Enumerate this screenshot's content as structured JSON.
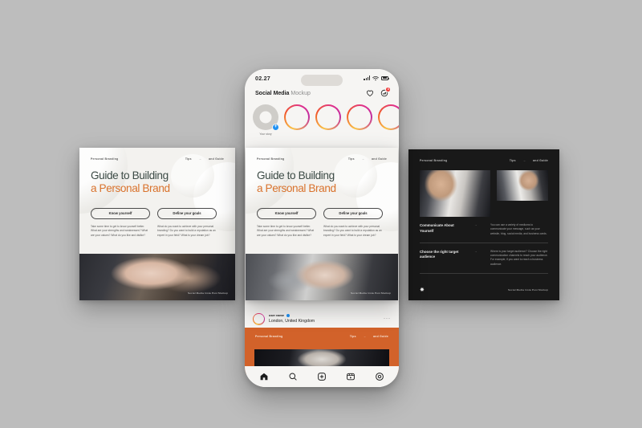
{
  "background_color": "#bdbdbd",
  "phone": {
    "status": {
      "time": "02.27",
      "signal_icon": "signal-bars-icon",
      "wifi_icon": "wifi-icon",
      "battery_icon": "battery-icon"
    },
    "header": {
      "title_bold": "Social Media",
      "title_light": "Mockup",
      "heart_icon": "heart-icon",
      "messenger_icon": "messenger-icon",
      "badge_count": "3"
    },
    "stories": [
      {
        "label": "Your story",
        "type": "own",
        "add_icon": "plus-icon"
      },
      {
        "label": "",
        "type": "ring"
      },
      {
        "label": "",
        "type": "ring"
      },
      {
        "label": "",
        "type": "ring"
      },
      {
        "label": "",
        "type": "ring"
      }
    ],
    "profile": {
      "username": "user name",
      "verified_icon": "verified-badge-icon",
      "location": "London, United Kingdom",
      "more_icon": "more-options-icon"
    },
    "tabbar": [
      {
        "icon": "home-icon",
        "label": "Home",
        "active": true
      },
      {
        "icon": "search-icon",
        "label": "Search",
        "active": false
      },
      {
        "icon": "add-post-icon",
        "label": "Create",
        "active": false
      },
      {
        "icon": "reels-icon",
        "label": "Reels",
        "active": false
      },
      {
        "icon": "profile-icon",
        "label": "Profile",
        "active": false
      }
    ]
  },
  "slide_light": {
    "kicker": "Personal Branding",
    "kicker_right_1": "Tips",
    "kicker_arrow": "→",
    "kicker_right_2": "and Guide",
    "headline_line1": "Guide to Building",
    "headline_line2": "a Personal Brand",
    "headline_color_1": "#3c4b46",
    "headline_color_2": "#d9722c",
    "pills": [
      {
        "label": "Know yourself",
        "body": "Take some time to get to know yourself better. What are your strengths and weaknesses? What are your values? What do you like and dislike?"
      },
      {
        "label": "Define your goals",
        "body": "What do you want to achieve with your personal branding? Do you want to build a reputation as an expert in your field? What is your dream job?"
      }
    ],
    "caption": "Social Media Insta Post Mockup"
  },
  "slide_dark": {
    "kicker": "Personal Branding",
    "kicker_right_1": "Tips",
    "kicker_arrow": "→",
    "kicker_right_2": "and Guide",
    "background_color": "#191919",
    "rows": [
      {
        "title": "Communicate About Yourself",
        "arrow": "→",
        "body": "You can use a variety of mediums to communicate your message, such as your website, blog, social media, and business cards."
      },
      {
        "title": "Choose the right target audience",
        "arrow": "→",
        "body": "Where is your target audience? Choose the right communication channels to reach your audience. For example, if you want to reach a business audience."
      }
    ],
    "snowflake_icon": "✸",
    "caption": "Social Media Insta Post Mockup"
  },
  "slide_orange": {
    "kicker": "Personal Branding",
    "kicker_right_1": "Tips",
    "kicker_arrow": "→",
    "kicker_right_2": "and Guide",
    "background_color": "#d2622a"
  }
}
